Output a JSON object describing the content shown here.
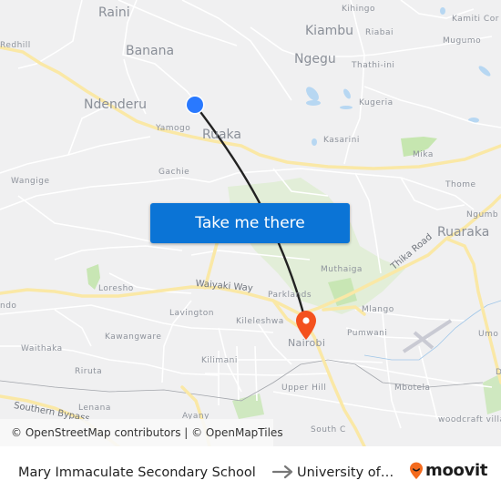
{
  "map": {
    "labels": {
      "raini": "Raini",
      "redhill": "Redhill",
      "banana": "Banana",
      "ndenderu": "Ndenderu",
      "yamogo": "Yamogo",
      "ruaka": "Ruaka",
      "gachie": "Gachie",
      "wangige": "Wangige",
      "kihingo": "Kihingo",
      "kiambu": "Kiambu",
      "riabai": "Riabai",
      "kamiti_corner": "Kamiti Cor",
      "mugumo": "Mugumo",
      "ngegu": "Ngegu",
      "thathi_ini": "Thathi-ini",
      "kugeria": "Kugeria",
      "kasarini": "Kasarini",
      "mika": "Mika",
      "thome": "Thome",
      "ngumba": "Ngumb",
      "ruaraka": "Ruaraka",
      "thika_road": "Thika Road",
      "muthaiga": "Muthaiga",
      "loresho": "Loresho",
      "waiyaki_way": "Waiyaki Way",
      "parklands": "Parklands",
      "kitisuru_partial": "ndo",
      "lavington": "Lavington",
      "kileleshwa": "Kileleshwa",
      "mlango": "Mlango",
      "nairobi": "Nairobi",
      "pumwani": "Pumwani",
      "umoja": "Umo",
      "kawangware": "Kawangware",
      "waithaka": "Waithaka",
      "kilimani": "Kilimani",
      "riruta": "Riruta",
      "upper_hill": "Upper Hill",
      "mbotela": "Mbotela",
      "donholm_partial": "D",
      "southern_bypass": "Southern Bypass",
      "lenana": "Lenana",
      "ayany": "Ayany",
      "south_c": "South C",
      "woodcraft": "woodcraft villa"
    },
    "origin_marker": {
      "icon": "origin-dot-icon",
      "color": "#2979ff"
    },
    "destination_marker": {
      "icon": "destination-pin-icon",
      "color": "#f4511e"
    },
    "route_color": "#222222"
  },
  "cta": {
    "label": "Take me there",
    "color": "#0b74d6"
  },
  "attribution": "© OpenStreetMap contributors | © OpenMapTiles",
  "footer": {
    "origin": "Mary Immaculate Secondary School",
    "arrow_icon": "arrow-right-icon",
    "destination": "University of Nairobi",
    "logo_text": "moovit",
    "logo_color": "#f46b1e"
  }
}
